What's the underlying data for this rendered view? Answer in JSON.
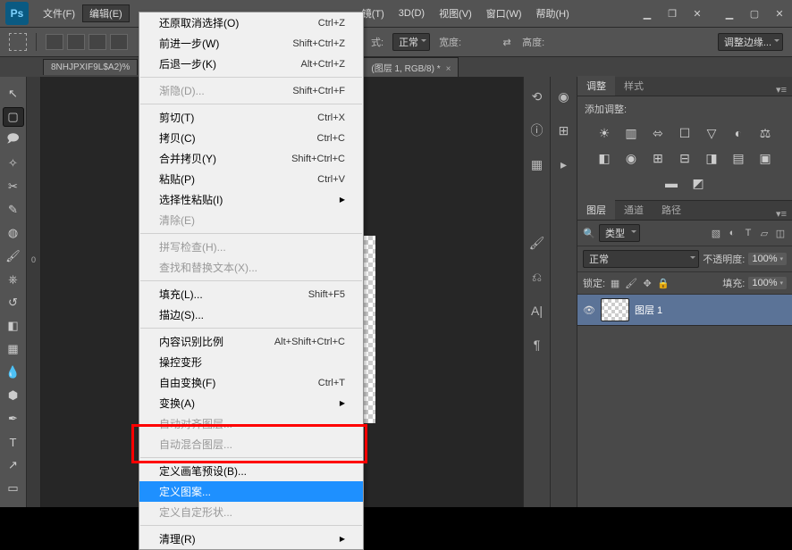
{
  "app": {
    "logo": "Ps"
  },
  "menubar": {
    "items": [
      {
        "label": "文件(F)"
      },
      {
        "label": "编辑(E)"
      },
      {
        "label": "镜(T)",
        "cut": true
      },
      {
        "label": "3D(D)"
      },
      {
        "label": "视图(V)"
      },
      {
        "label": "窗口(W)"
      },
      {
        "label": "帮助(H)"
      }
    ]
  },
  "options": {
    "mode_label": "式:",
    "mode_value": "正常",
    "width_label": "宽度:",
    "height_label": "高度:",
    "refine": "调整边缘..."
  },
  "docs": {
    "tab1": "8NHJPXIF9L$A2)%",
    "tab2": "(图层 1, RGB/8) *"
  },
  "ruler": {
    "v0": "0"
  },
  "edit_menu": {
    "items": [
      {
        "label": "还原取消选择(O)",
        "shortcut": "Ctrl+Z"
      },
      {
        "label": "前进一步(W)",
        "shortcut": "Shift+Ctrl+Z"
      },
      {
        "label": "后退一步(K)",
        "shortcut": "Alt+Ctrl+Z"
      },
      {
        "sep": true
      },
      {
        "label": "渐隐(D)...",
        "shortcut": "Shift+Ctrl+F",
        "disabled": true
      },
      {
        "sep": true
      },
      {
        "label": "剪切(T)",
        "shortcut": "Ctrl+X"
      },
      {
        "label": "拷贝(C)",
        "shortcut": "Ctrl+C"
      },
      {
        "label": "合并拷贝(Y)",
        "shortcut": "Shift+Ctrl+C"
      },
      {
        "label": "粘贴(P)",
        "shortcut": "Ctrl+V"
      },
      {
        "label": "选择性粘贴(I)",
        "submenu": true
      },
      {
        "label": "清除(E)",
        "disabled": true
      },
      {
        "sep": true
      },
      {
        "label": "拼写检查(H)...",
        "disabled": true
      },
      {
        "label": "查找和替换文本(X)...",
        "disabled": true
      },
      {
        "sep": true
      },
      {
        "label": "填充(L)...",
        "shortcut": "Shift+F5"
      },
      {
        "label": "描边(S)..."
      },
      {
        "sep": true
      },
      {
        "label": "内容识别比例",
        "shortcut": "Alt+Shift+Ctrl+C"
      },
      {
        "label": "操控变形"
      },
      {
        "label": "自由变换(F)",
        "shortcut": "Ctrl+T"
      },
      {
        "label": "变换(A)",
        "submenu": true
      },
      {
        "label": "自动对齐图层...",
        "disabled": true
      },
      {
        "label": "自动混合图层...",
        "disabled": true
      },
      {
        "sep": true
      },
      {
        "label": "定义画笔预设(B)..."
      },
      {
        "label": "定义图案...",
        "highlight": true
      },
      {
        "label": "定义自定形状...",
        "disabled": true
      },
      {
        "sep": true
      },
      {
        "label": "清理(R)",
        "submenu": true
      }
    ]
  },
  "adjustments": {
    "tab1": "调整",
    "tab2": "样式",
    "label": "添加调整:"
  },
  "layers": {
    "tab1": "图层",
    "tab2": "通道",
    "tab3": "路径",
    "filter": "类型",
    "blend": "正常",
    "opacity_label": "不透明度:",
    "opacity_val": "100%",
    "lock_label": "锁定:",
    "fill_label": "填充:",
    "fill_val": "100%",
    "layer1": "图层 1"
  }
}
